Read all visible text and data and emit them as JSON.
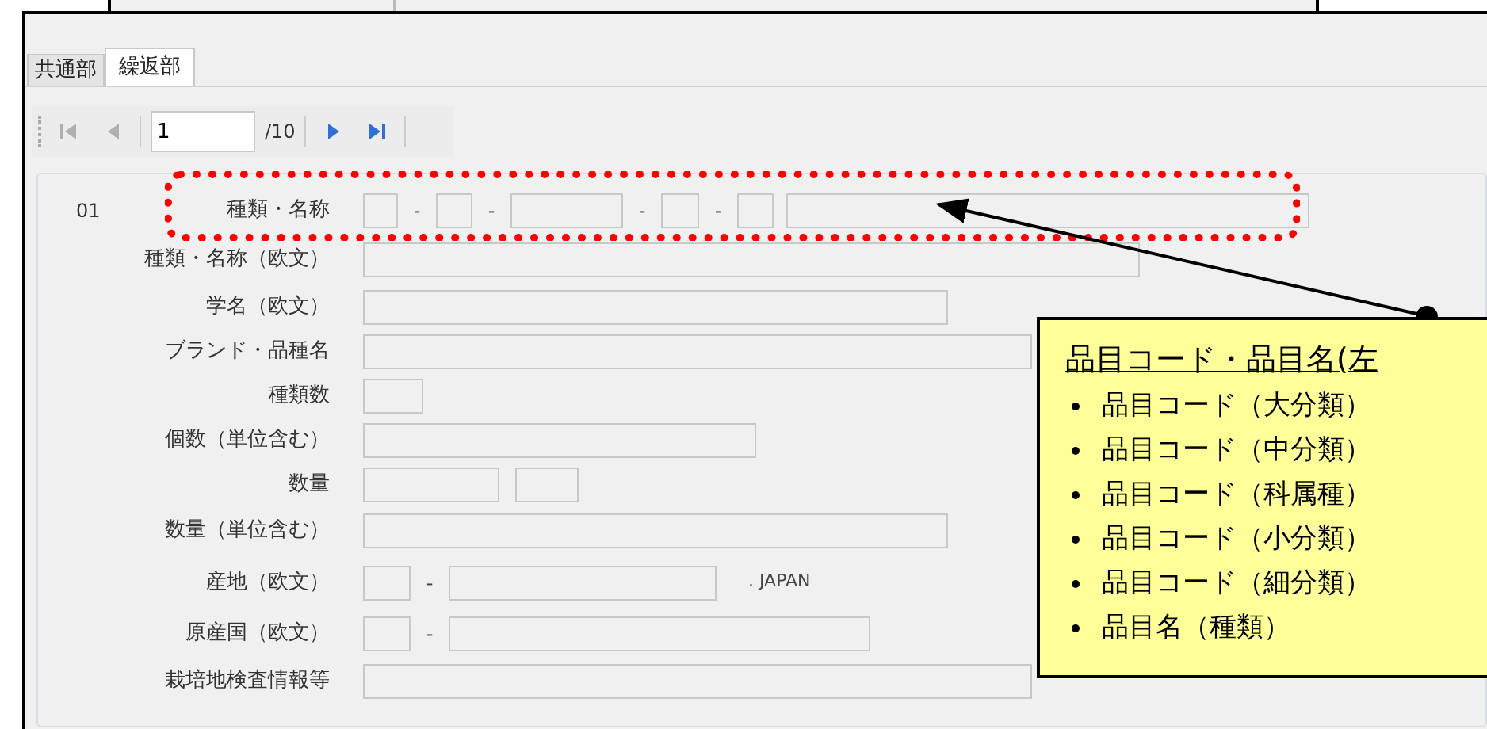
{
  "tabs": [
    {
      "label": "共通部",
      "selected": false
    },
    {
      "label": "繰返部",
      "selected": true
    }
  ],
  "pager": {
    "buttons": [
      {
        "kind": "first",
        "disabled": true
      },
      {
        "kind": "prev",
        "disabled": true
      }
    ],
    "page": "1",
    "total": "/10",
    "next_buttons": [
      {
        "kind": "next",
        "disabled": false
      },
      {
        "kind": "last",
        "disabled": false
      }
    ]
  },
  "record_number": "01",
  "rows": [
    {
      "label": "種類・名称",
      "highlighted": true,
      "parts": [
        {
          "kind": "input"
        },
        {
          "kind": "sep",
          "text": "-"
        },
        {
          "kind": "input"
        },
        {
          "kind": "sep",
          "text": "-"
        },
        {
          "kind": "input"
        },
        {
          "kind": "sep",
          "text": "-"
        },
        {
          "kind": "input"
        },
        {
          "kind": "sep",
          "text": "-"
        },
        {
          "kind": "input"
        },
        {
          "kind": "input"
        }
      ]
    },
    {
      "label": "種類・名称（欧文）",
      "highlighted": false,
      "parts": [
        {
          "kind": "input"
        }
      ]
    },
    {
      "label": "学名（欧文）",
      "highlighted": false,
      "parts": [
        {
          "kind": "input"
        }
      ]
    },
    {
      "label": "ブランド・品種名",
      "highlighted": false,
      "parts": [
        {
          "kind": "input"
        }
      ]
    },
    {
      "label": "種類数",
      "highlighted": false,
      "parts": [
        {
          "kind": "input"
        }
      ]
    },
    {
      "label": "個数（単位含む）",
      "highlighted": false,
      "parts": [
        {
          "kind": "input"
        }
      ]
    },
    {
      "label": "数量",
      "highlighted": false,
      "parts": [
        {
          "kind": "input"
        },
        {
          "kind": "input"
        }
      ]
    },
    {
      "label": "数量（単位含む）",
      "highlighted": false,
      "parts": [
        {
          "kind": "input"
        }
      ]
    },
    {
      "label": "産地（欧文）",
      "highlighted": false,
      "parts": [
        {
          "kind": "input"
        },
        {
          "kind": "sep",
          "text": "-"
        },
        {
          "kind": "input"
        },
        {
          "kind": "text",
          "text": ". JAPAN"
        }
      ]
    },
    {
      "label": "原産国（欧文）",
      "highlighted": false,
      "parts": [
        {
          "kind": "input"
        },
        {
          "kind": "sep",
          "text": "-"
        },
        {
          "kind": "input"
        }
      ]
    },
    {
      "label": "栽培地検査情報等",
      "highlighted": false,
      "parts": [
        {
          "kind": "input"
        }
      ]
    }
  ],
  "callout": {
    "title": "品目コード・品目名(左",
    "items": [
      "品目コード（大分類）",
      "品目コード（中分類）",
      "品目コード（科属種）",
      "品目コード（小分類）",
      "品目コード（細分類）",
      "品目名（種類）"
    ]
  }
}
